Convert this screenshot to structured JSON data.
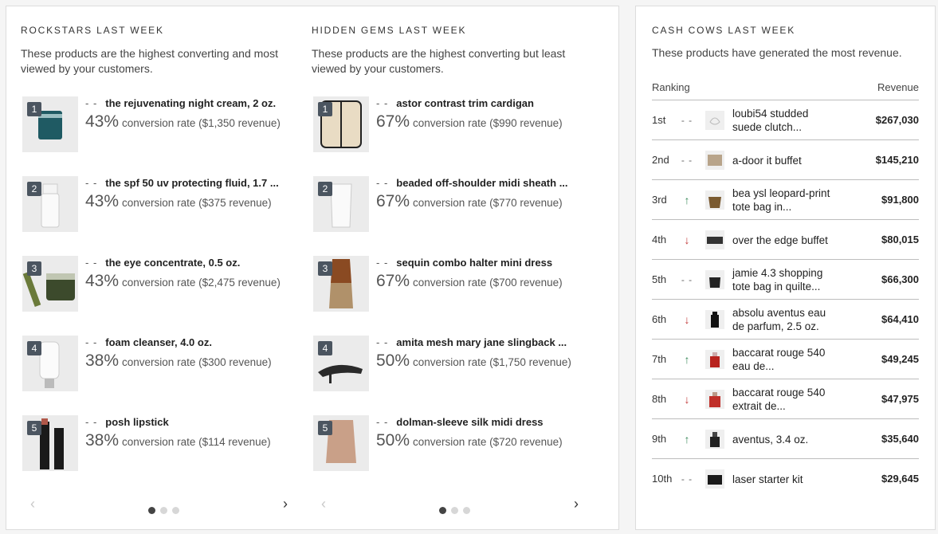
{
  "rockstars": {
    "title": "ROCKSTARS LAST WEEK",
    "description": "These products are the highest converting and most viewed by your customers.",
    "items": [
      {
        "rank": "1",
        "trend": "- -",
        "name": "the rejuvenating night cream, 2 oz.",
        "pct": "43%",
        "conv": "conversion rate ($1,350 revenue)"
      },
      {
        "rank": "2",
        "trend": "- -",
        "name": "the spf 50 uv protecting fluid, 1.7 ...",
        "pct": "43%",
        "conv": "conversion rate ($375 revenue)"
      },
      {
        "rank": "3",
        "trend": "- -",
        "name": "the eye concentrate, 0.5 oz.",
        "pct": "43%",
        "conv": "conversion rate ($2,475 revenue)"
      },
      {
        "rank": "4",
        "trend": "- -",
        "name": "foam cleanser, 4.0 oz.",
        "pct": "38%",
        "conv": "conversion rate ($300 revenue)"
      },
      {
        "rank": "5",
        "trend": "- -",
        "name": "posh lipstick",
        "pct": "38%",
        "conv": "conversion rate ($114 revenue)"
      }
    ]
  },
  "hidden_gems": {
    "title": "HIDDEN GEMS LAST WEEK",
    "description": "These products are the highest converting but least viewed by your customers.",
    "items": [
      {
        "rank": "1",
        "trend": "- -",
        "name": "astor contrast trim cardigan",
        "pct": "67%",
        "conv": "conversion rate ($990 revenue)"
      },
      {
        "rank": "2",
        "trend": "- -",
        "name": "beaded off-shoulder midi sheath ...",
        "pct": "67%",
        "conv": "conversion rate ($770 revenue)"
      },
      {
        "rank": "3",
        "trend": "- -",
        "name": "sequin combo halter mini dress",
        "pct": "67%",
        "conv": "conversion rate ($700 revenue)"
      },
      {
        "rank": "4",
        "trend": "- -",
        "name": "amita mesh mary jane slingback ...",
        "pct": "50%",
        "conv": "conversion rate ($1,750 revenue)"
      },
      {
        "rank": "5",
        "trend": "- -",
        "name": "dolman-sleeve silk midi dress",
        "pct": "50%",
        "conv": "conversion rate ($720 revenue)"
      }
    ]
  },
  "pager": {
    "prev_icon": "chevron-left-icon",
    "next_icon": "chevron-right-icon",
    "prev": "‹",
    "next": "›",
    "pages": 3,
    "active": 1
  },
  "cash_cows": {
    "title": "CASH COWS LAST WEEK",
    "description": "These products have generated the most revenue.",
    "header_ranking": "Ranking",
    "header_revenue": "Revenue",
    "rows": [
      {
        "rank": "1st",
        "trend": "flat",
        "trend_glyph": "- -",
        "name": "loubi54 studded suede clutch...",
        "revenue": "$267,030"
      },
      {
        "rank": "2nd",
        "trend": "flat",
        "trend_glyph": "- -",
        "name": "a-door it buffet",
        "revenue": "$145,210"
      },
      {
        "rank": "3rd",
        "trend": "up",
        "trend_glyph": "↑",
        "name": "bea ysl leopard-print tote bag in...",
        "revenue": "$91,800"
      },
      {
        "rank": "4th",
        "trend": "down",
        "trend_glyph": "↓",
        "name": "over the edge buffet",
        "revenue": "$80,015"
      },
      {
        "rank": "5th",
        "trend": "flat",
        "trend_glyph": "- -",
        "name": "jamie 4.3 shopping tote bag in quilte...",
        "revenue": "$66,300"
      },
      {
        "rank": "6th",
        "trend": "down",
        "trend_glyph": "↓",
        "name": "absolu aventus eau de parfum, 2.5 oz.",
        "revenue": "$64,410"
      },
      {
        "rank": "7th",
        "trend": "up",
        "trend_glyph": "↑",
        "name": "baccarat rouge 540 eau de...",
        "revenue": "$49,245"
      },
      {
        "rank": "8th",
        "trend": "down",
        "trend_glyph": "↓",
        "name": "baccarat rouge 540 extrait de...",
        "revenue": "$47,975"
      },
      {
        "rank": "9th",
        "trend": "up",
        "trend_glyph": "↑",
        "name": "aventus, 3.4 oz.",
        "revenue": "$35,640"
      },
      {
        "rank": "10th",
        "trend": "flat",
        "trend_glyph": "- -",
        "name": "laser starter kit",
        "revenue": "$29,645"
      }
    ]
  },
  "colors": {
    "badge": "#4b5560",
    "up": "#3a8a5b",
    "down": "#c23a3a",
    "dot_active": "#444444",
    "dot": "#d7d7d7"
  }
}
